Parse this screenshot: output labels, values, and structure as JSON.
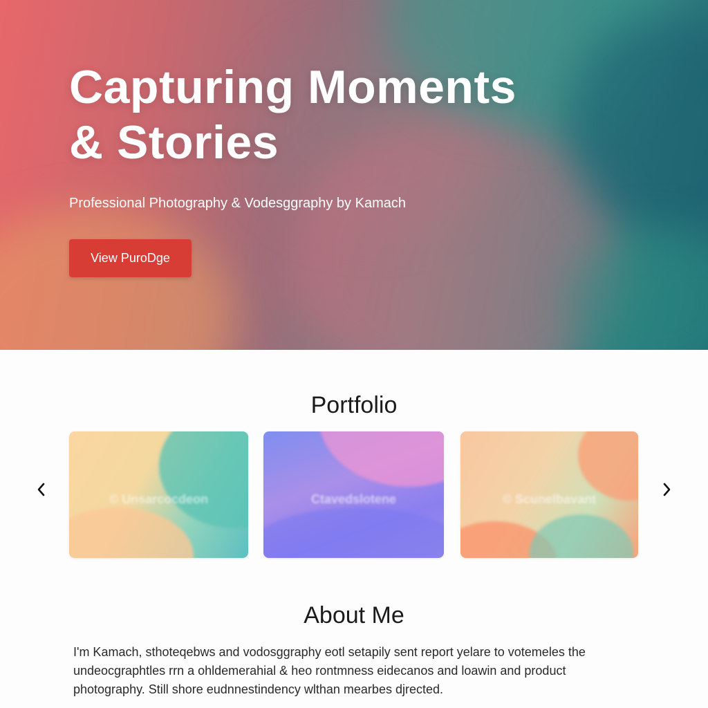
{
  "hero": {
    "title_line1": "Capturing Moments",
    "title_line2": "& Stories",
    "subtitle": "Professional Photography & Vodesggraphy by Kamach",
    "cta_label": "View PuroDge"
  },
  "portfolio": {
    "title": "Portfolio",
    "prev_icon": "chevron-left-icon",
    "next_icon": "chevron-right-icon",
    "cards": [
      {
        "label": "© Unsarcocdeon"
      },
      {
        "label": "Ctavedslotene"
      },
      {
        "label": "© Scunelbavant"
      }
    ]
  },
  "about": {
    "title": "About Me",
    "text": "I'm Kamach, sthoteqebws and vodosggraphy eotl setapily sent report yelare to votemeles the undeocgraphtles rrn a ohldemerahial & heo rontmness eidecanos and loawin and product photography. Still shore eudnnestindency wlthan mearbes djrected."
  },
  "colors": {
    "cta": "#d83d35",
    "heading": "#1b1b1b",
    "body_text": "#2a2a2a"
  }
}
